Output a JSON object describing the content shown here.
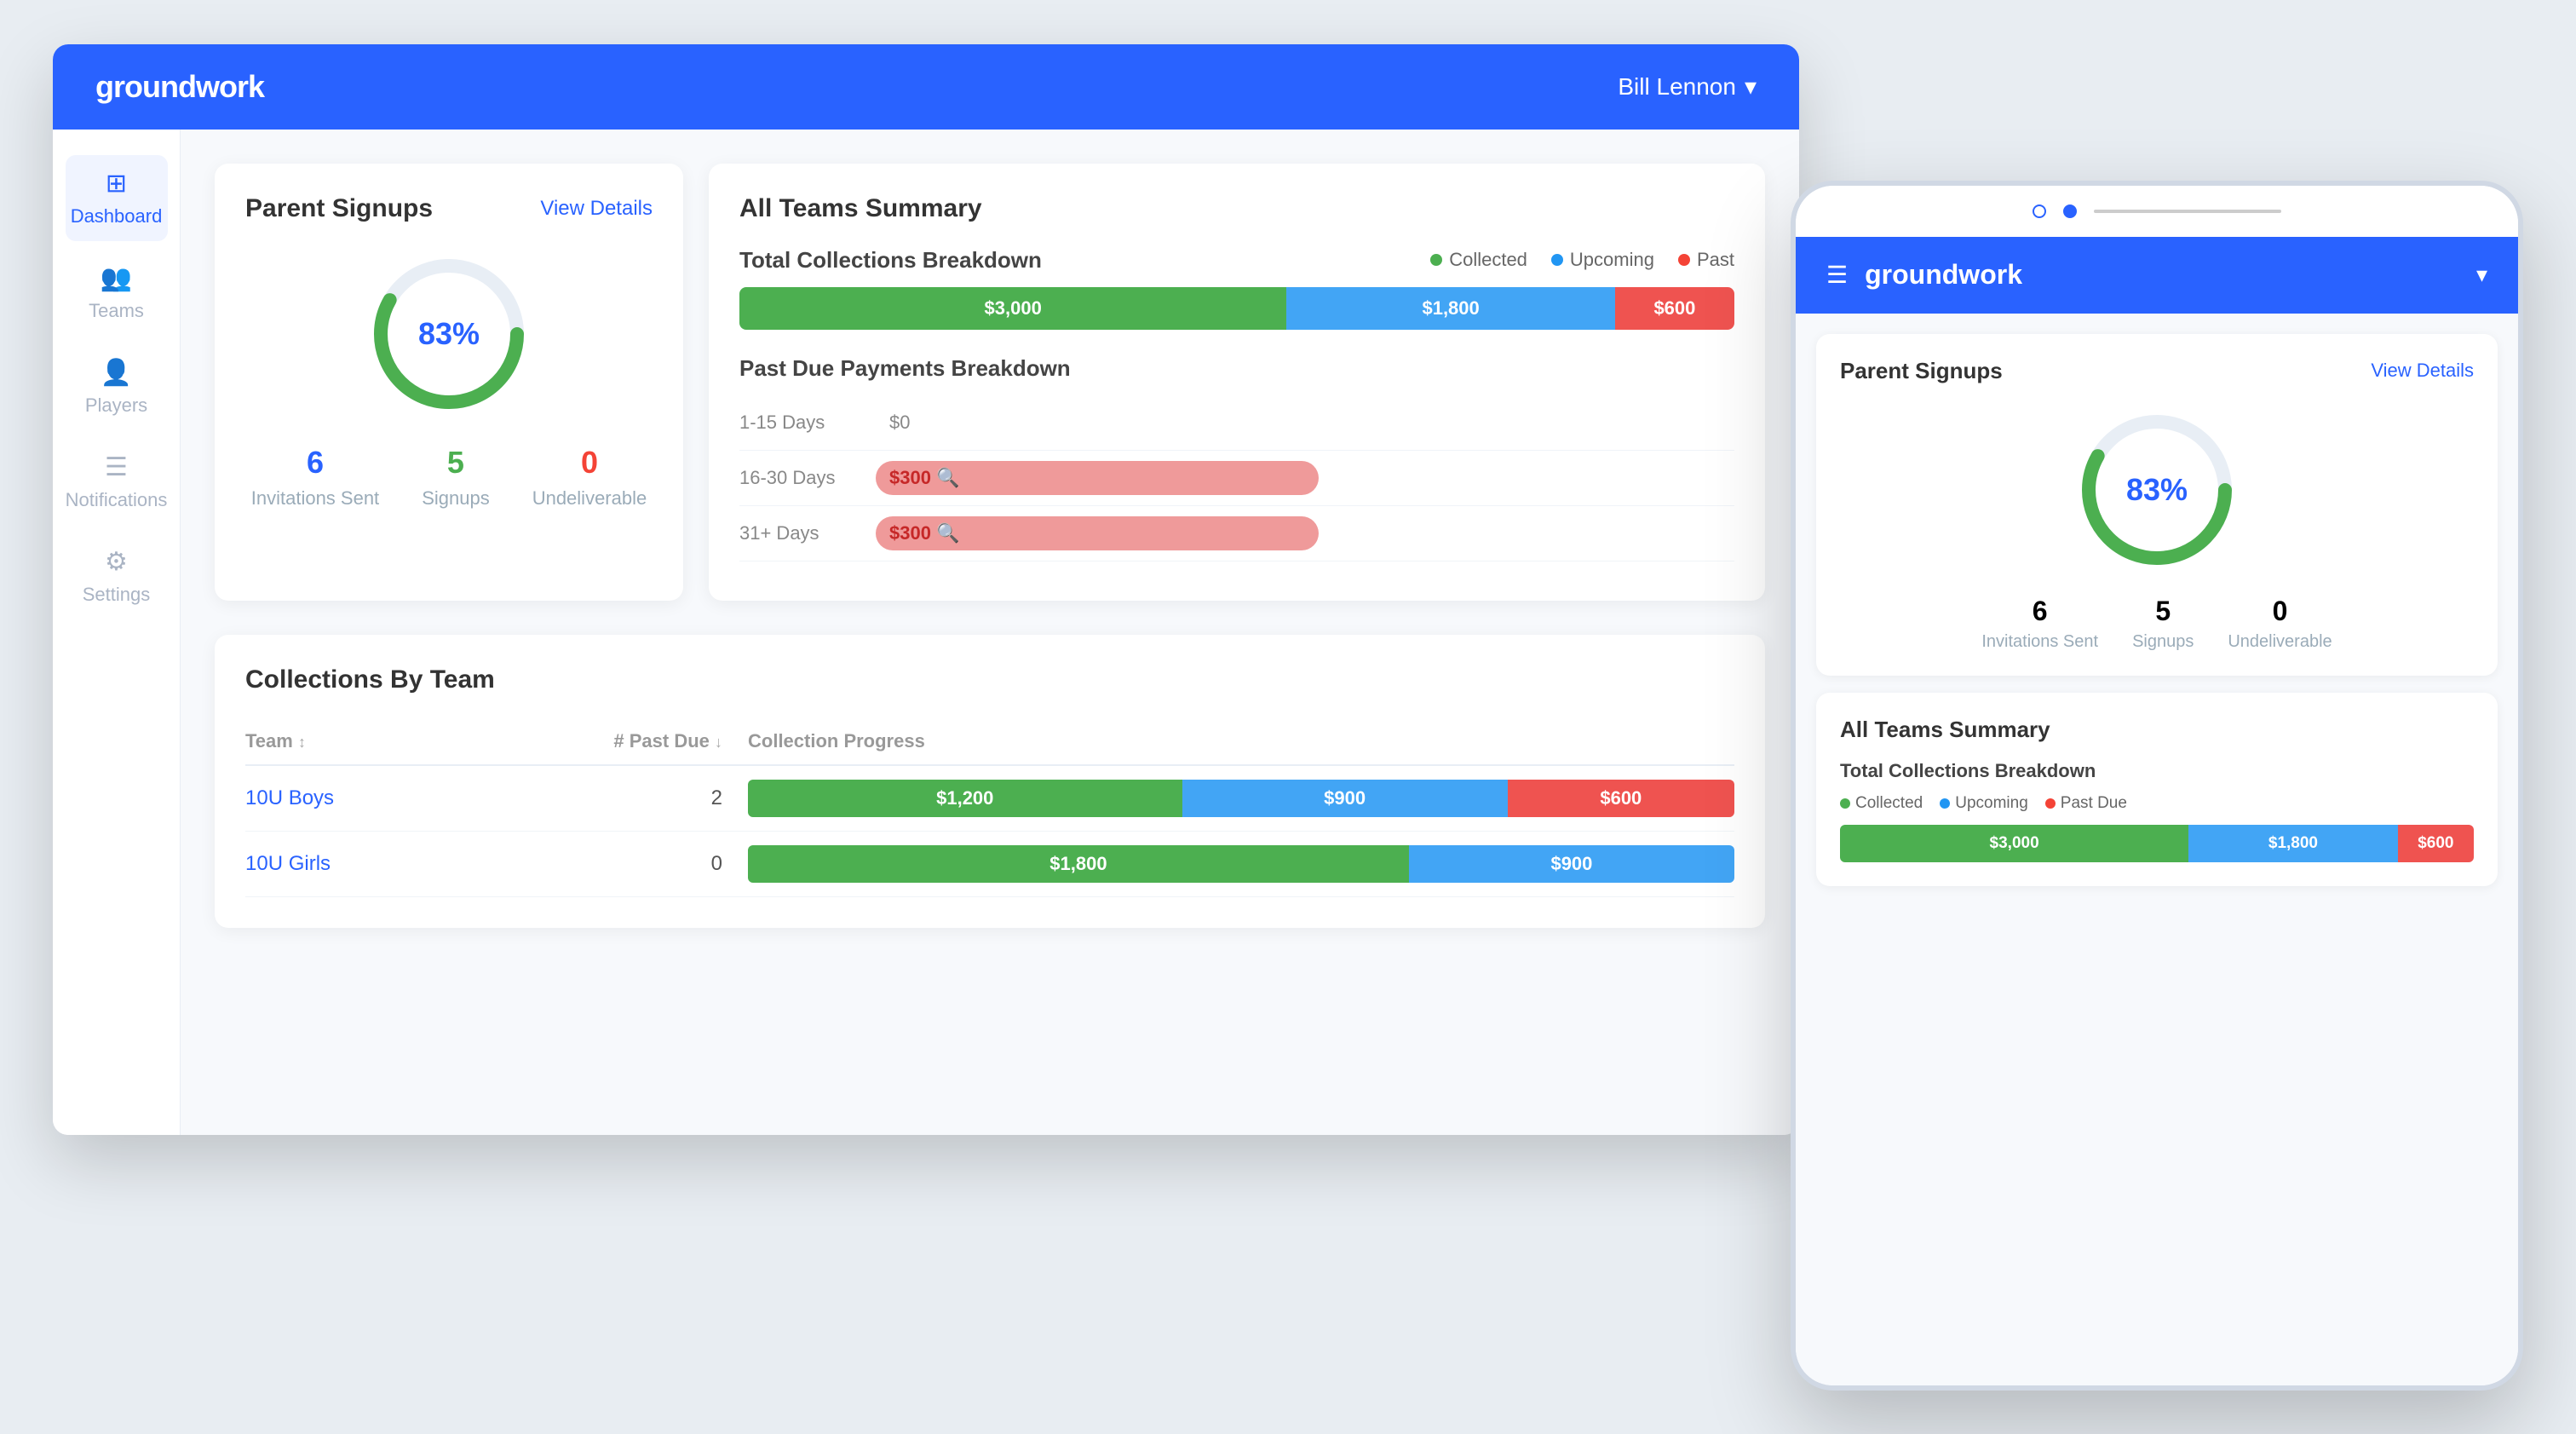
{
  "app": {
    "logo": "groundwork",
    "user": "Bill Lennon",
    "user_caret": "▾"
  },
  "sidebar": {
    "items": [
      {
        "id": "dashboard",
        "label": "Dashboard",
        "icon": "⊞",
        "active": true
      },
      {
        "id": "teams",
        "label": "Teams",
        "icon": "👥"
      },
      {
        "id": "players",
        "label": "Players",
        "icon": "👤"
      },
      {
        "id": "notifications",
        "label": "Notifications",
        "icon": "☰"
      },
      {
        "id": "settings",
        "label": "Settings",
        "icon": "⚙"
      }
    ]
  },
  "parent_signups": {
    "title": "Parent Signups",
    "view_details": "View Details",
    "donut_percent": "83%",
    "invitations_sent_value": "6",
    "invitations_sent_label": "Invitations Sent",
    "signups_value": "5",
    "signups_label": "Signups",
    "undeliverable_value": "0",
    "undeliverable_label": "Undeliverable"
  },
  "teams_summary": {
    "title": "All Teams Summary",
    "breakdown": {
      "title": "Total Collections Breakdown",
      "legend": {
        "collected": "Collected",
        "upcoming": "Upcoming",
        "past": "Past"
      },
      "collected_value": "$3,000",
      "upcoming_value": "$1,800",
      "past_value": "$600",
      "collected_pct": 55,
      "upcoming_pct": 33,
      "past_pct": 12
    },
    "past_due": {
      "title": "Past Due Payments Breakdown",
      "rows": [
        {
          "label": "1-15 Days",
          "value": "$0",
          "filled": false
        },
        {
          "label": "16-30 Days",
          "value": "$300",
          "filled": true
        },
        {
          "label": "31+ Days",
          "value": "$300",
          "filled": true
        }
      ]
    }
  },
  "collections_table": {
    "title": "Collections By Team",
    "header_team": "Team",
    "header_pastdue": "# Past Due",
    "header_progress": "Collection Progress",
    "rows": [
      {
        "team": "10U Boys",
        "past_due": "2",
        "collected": "$1,200",
        "upcoming": "$900",
        "red": "$600",
        "collected_pct": 44,
        "upcoming_pct": 33,
        "red_pct": 23
      },
      {
        "team": "10U Girls",
        "past_due": "0",
        "collected": "$1,800",
        "upcoming": "$900",
        "red": "",
        "collected_pct": 67,
        "upcoming_pct": 33,
        "red_pct": 0
      }
    ]
  },
  "mobile": {
    "logo": "groundwork",
    "parent_signups_title": "Parent Signups",
    "view_details": "View Details",
    "donut_percent": "83%",
    "invitations_value": "6",
    "invitations_label": "Invitations Sent",
    "signups_value": "5",
    "signups_label": "Signups",
    "undeliverable_value": "0",
    "undeliverable_label": "Undeliverable",
    "teams_summary_title": "All Teams Summary",
    "breakdown_title": "Total Collections Breakdown",
    "legend_collected": "Collected",
    "legend_upcoming": "Upcoming",
    "legend_past": "Past Due",
    "bar_collected": "$3,000",
    "bar_upcoming": "$1,800",
    "bar_past": "$600"
  }
}
